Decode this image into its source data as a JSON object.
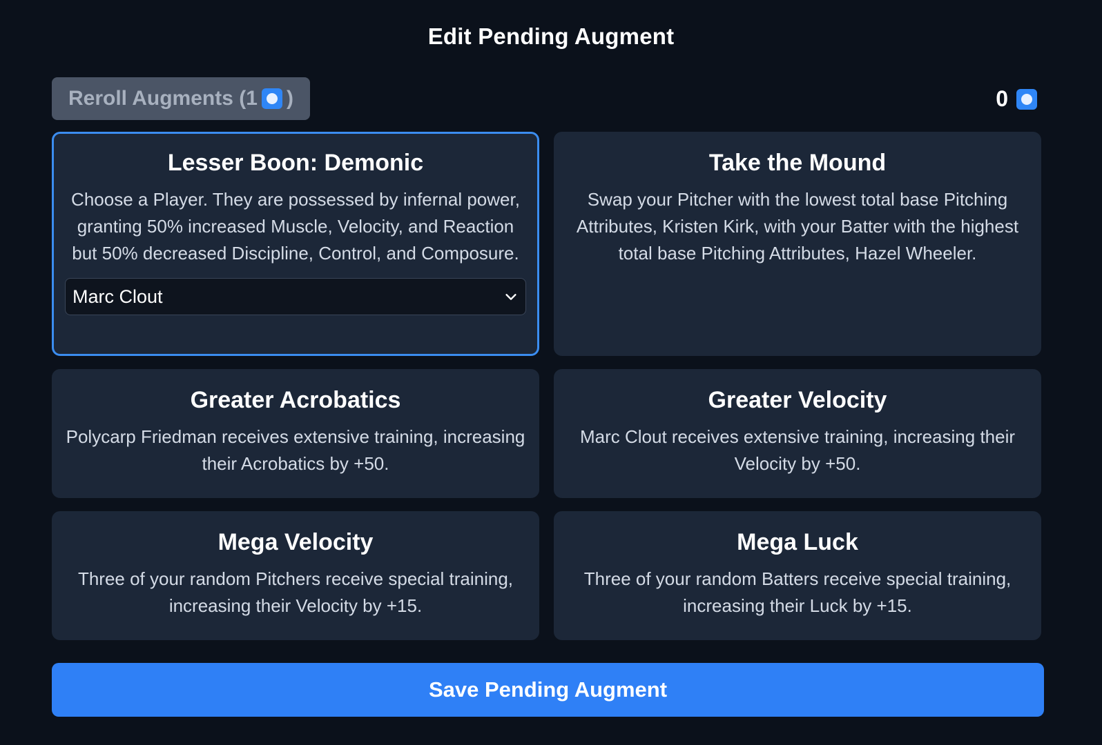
{
  "dialog": {
    "title": "Edit Pending Augment"
  },
  "reroll": {
    "label_prefix": "Reroll Augments (1",
    "label_suffix": ")",
    "cost_icon": "gem-icon"
  },
  "currency": {
    "amount": "0",
    "icon": "gem-icon"
  },
  "augments": [
    {
      "title": "Lesser Boon: Demonic",
      "description": "Choose a Player. They are possessed by infernal power, granting 50% increased Muscle, Velocity, and Reaction but 50% decreased Discipline, Control, and Composure.",
      "selected": true,
      "player_select": {
        "value": "Marc Clout"
      }
    },
    {
      "title": "Take the Mound",
      "description": "Swap your Pitcher with the lowest total base Pitching Attributes, Kristen Kirk, with your Batter with the highest total base Pitching Attributes, Hazel Wheeler.",
      "selected": false
    },
    {
      "title": "Greater Acrobatics",
      "description": "Polycarp Friedman receives extensive training, increasing their Acrobatics by +50.",
      "selected": false
    },
    {
      "title": "Greater Velocity",
      "description": "Marc Clout receives extensive training, increasing their Velocity by +50.",
      "selected": false
    },
    {
      "title": "Mega Velocity",
      "description": "Three of your random Pitchers receive special training, increasing their Velocity by +15.",
      "selected": false
    },
    {
      "title": "Mega Luck",
      "description": "Three of your random Batters receive special training, increasing their Luck by +15.",
      "selected": false
    }
  ],
  "save": {
    "label": "Save Pending Augment"
  },
  "colors": {
    "background": "#0b111b",
    "card": "#1c2738",
    "accent": "#2f80f6",
    "selected_border": "#3b8df0"
  }
}
